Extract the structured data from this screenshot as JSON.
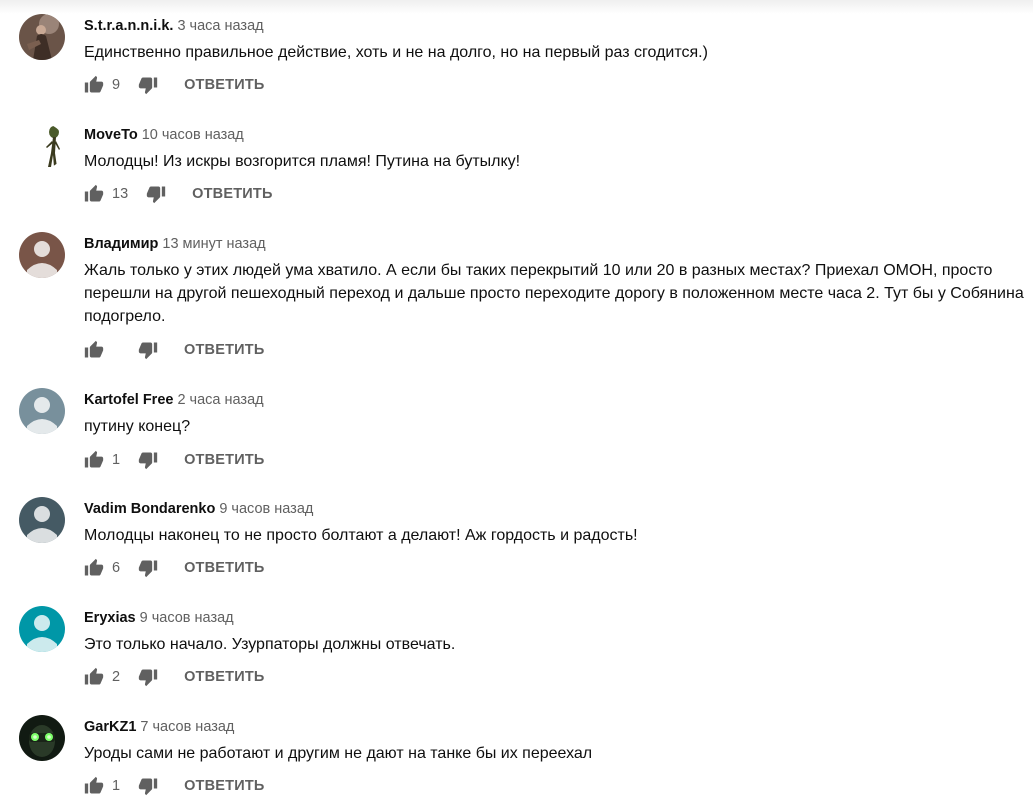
{
  "colors": {
    "icon": "#606060",
    "meta": "#606060",
    "text": "#0f0f0f"
  },
  "reply_label": "ОТВЕТИТЬ",
  "comments": [
    {
      "author": "S.t.r.a.n.n.i.k.",
      "time": "3 часа назад",
      "text": "Единственно правильное действие, хоть и не на долго, но на первый раз сгодится.)",
      "likes": "9",
      "avatar": "photo-figure"
    },
    {
      "author": "MoveTo",
      "time": "10 часов назад",
      "text": "Молодцы! Из искры возгорится пламя! Путина на бутылку!",
      "likes": "13",
      "avatar": "alien-figure"
    },
    {
      "author": "Владимир",
      "time": "13 минут назад",
      "text": "Жаль только у этих людей ума хватило. А если бы таких перекрытий 10 или 20 в разных местах? Приехал ОМОН, просто перешли на другой пешеходный переход и дальше просто переходите дорогу в положенном месте часа 2. Тут бы у Собянина подогрело.",
      "likes": "",
      "avatar": "default-brown"
    },
    {
      "author": "Kartofel Free",
      "time": "2 часа назад",
      "text": "путину конец?",
      "likes": "1",
      "avatar": "default-grey"
    },
    {
      "author": "Vadim Bondarenko",
      "time": "9 часов назад",
      "text": "Молодцы наконец то не просто болтают а делают! Аж гордость и радость!",
      "likes": "6",
      "avatar": "default-slate"
    },
    {
      "author": "Eryxias",
      "time": "9 часов назад",
      "text": "Это только начало. Узурпаторы должны отвечать.",
      "likes": "2",
      "avatar": "default-teal"
    },
    {
      "author": "GarKZ1",
      "time": "7 часов назад",
      "text": "Уроды сами не работают и другим не дают на танке бы их переехал",
      "likes": "1",
      "avatar": "photo-goggles"
    }
  ]
}
